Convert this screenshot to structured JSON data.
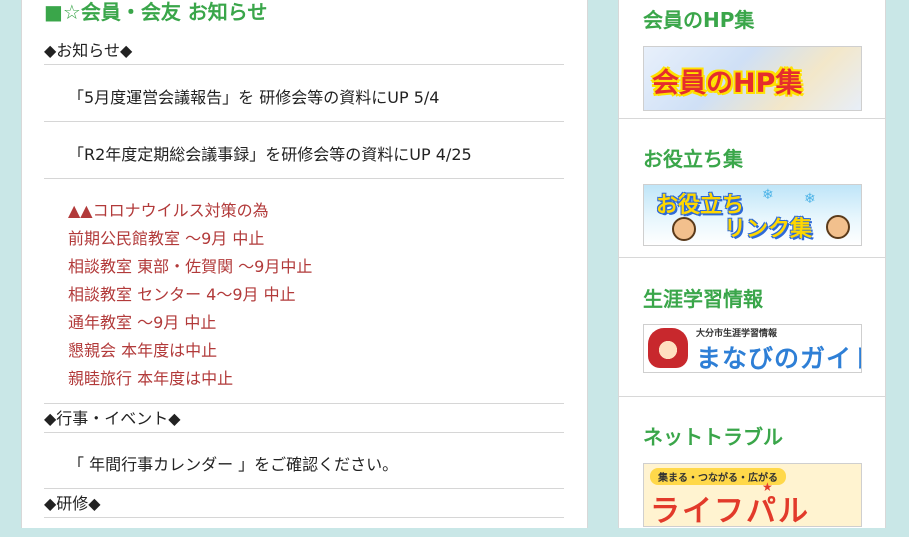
{
  "main": {
    "title": "■☆会員・会友 お知らせ",
    "sections": {
      "notice": "◆お知らせ◆",
      "events": "◆行事・イベント◆",
      "training": "◆研修◆"
    },
    "notices": [
      "「5月度運営会議報告」を 研修会等の資料にUP 5/4",
      "「R2年度定期総会議事録」を研修会等の資料にUP 4/25"
    ],
    "covid_lines": [
      "▲▲コロナウイルス対策の為",
      "前期公民館教室 ～9月 中止",
      "相談教室 東部・佐賀関 ～9月中止",
      "相談教室 センター 4～9月 中止",
      "通年教室 ～9月 中止",
      "懇親会  本年度は中止",
      "親睦旅行 本年度は中止"
    ],
    "event_text": "「 年間行事カレンダー 」をご確認ください。"
  },
  "sidebar": {
    "blocks": [
      {
        "title": "会員のHP集",
        "banner_text": "会員のHP集"
      },
      {
        "title": "お役立ち集",
        "banner_line1": "お役立ち",
        "banner_line2": "リンク集"
      },
      {
        "title": "生涯学習情報",
        "banner_small": "大分市生涯学習情報",
        "banner_big": "まなびのガイド"
      },
      {
        "title": "ネットトラブル",
        "banner_small": "集まる・つながる・広がる",
        "banner_big": "ライフパル"
      }
    ]
  },
  "colors": {
    "accent_green": "#3aa64a",
    "alert_red": "#b23a3a",
    "background": "#c9e7e7"
  }
}
